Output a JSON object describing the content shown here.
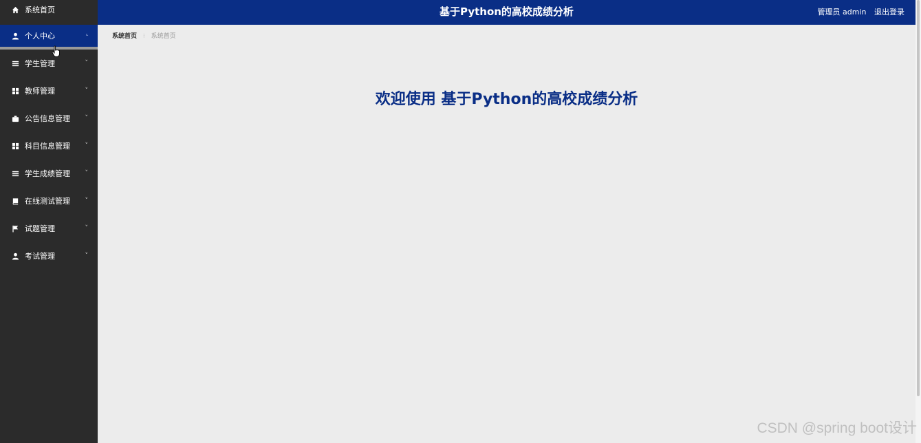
{
  "sidebar": {
    "items": [
      {
        "label": "系统首页",
        "icon": "home-icon",
        "chevron": ""
      },
      {
        "label": "个人中心",
        "icon": "user-icon",
        "chevron": "ᴸ"
      },
      {
        "label": "学生管理",
        "icon": "list-icon",
        "chevron": "˅"
      },
      {
        "label": "教师管理",
        "icon": "grid-icon",
        "chevron": "˅"
      },
      {
        "label": "公告信息管理",
        "icon": "briefcase-icon",
        "chevron": "˅"
      },
      {
        "label": "科目信息管理",
        "icon": "grid-icon",
        "chevron": "˅"
      },
      {
        "label": "学生成绩管理",
        "icon": "list-icon",
        "chevron": "˅"
      },
      {
        "label": "在线测试管理",
        "icon": "book-icon",
        "chevron": "˅"
      },
      {
        "label": "试题管理",
        "icon": "flag-icon",
        "chevron": "˅"
      },
      {
        "label": "考试管理",
        "icon": "user-icon",
        "chevron": "˅"
      }
    ]
  },
  "header": {
    "title": "基于Python的高校成绩分析",
    "user": "管理员 admin",
    "logout": "退出登录"
  },
  "breadcrumb": {
    "root": "系统首页",
    "separator": "⁝",
    "current": "系统首页"
  },
  "welcome": "欢迎使用 基于Python的高校成绩分析",
  "watermark": "CSDN @spring boot设计",
  "colors": {
    "primary": "#0a2e86",
    "sidebar": "#2b2b2b",
    "background": "#ececec"
  }
}
